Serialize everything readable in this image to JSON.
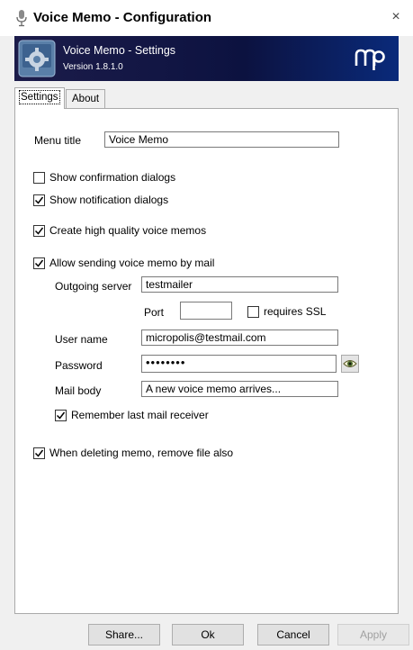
{
  "window": {
    "title": "Voice Memo - Configuration",
    "close_label": "×"
  },
  "banner": {
    "title": "Voice Memo - Settings",
    "version": "Version 1.8.1.0",
    "brand_color": "#0c1240"
  },
  "tabs": [
    {
      "label": "Settings",
      "active": true
    },
    {
      "label": "About",
      "active": false
    }
  ],
  "settings": {
    "menu_title_label": "Menu title",
    "menu_title_value": "Voice Memo",
    "show_confirmation": {
      "label": "Show confirmation dialogs",
      "checked": false
    },
    "show_notification": {
      "label": "Show notification dialogs",
      "checked": true
    },
    "high_quality": {
      "label": "Create high quality voice memos",
      "checked": true
    },
    "allow_mail": {
      "label": "Allow sending voice memo by mail",
      "checked": true
    },
    "outgoing_server_label": "Outgoing server",
    "outgoing_server_value": "testmailer",
    "port_label": "Port",
    "port_value": "",
    "requires_ssl": {
      "label": "requires SSL",
      "checked": false
    },
    "user_name_label": "User name",
    "user_name_value": "micropolis@testmail.com",
    "password_label": "Password",
    "password_value": "••••••••",
    "mail_body_label": "Mail body",
    "mail_body_value": "A new voice memo arrives...",
    "remember_receiver": {
      "label": "Remember last mail receiver",
      "checked": true
    },
    "delete_file": {
      "label": "When deleting memo, remove file also",
      "checked": true
    }
  },
  "buttons": {
    "share": "Share...",
    "ok": "Ok",
    "cancel": "Cancel",
    "apply": "Apply"
  }
}
